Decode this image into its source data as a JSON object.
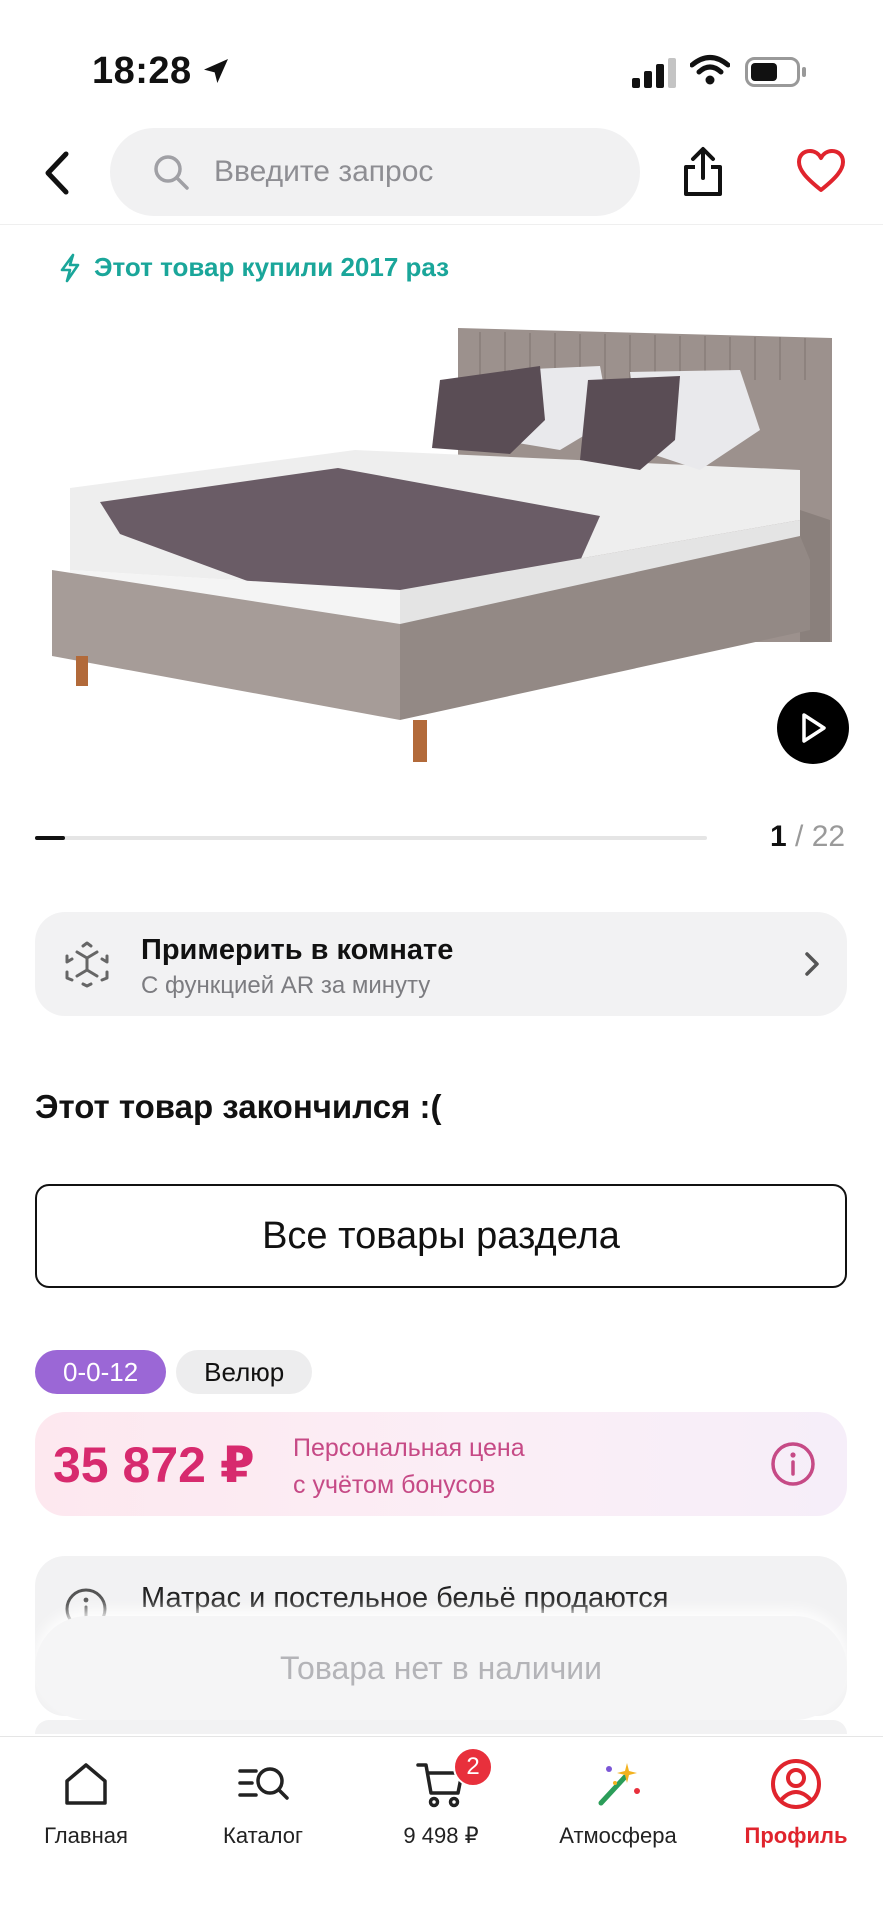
{
  "status_bar": {
    "time": "18:28"
  },
  "search": {
    "placeholder": "Введите запрос"
  },
  "product": {
    "bought_badge": "Этот товар купили 2017 раз",
    "gallery_current": "1",
    "gallery_separator": "/",
    "gallery_total": "22",
    "gallery_progress": 0.045,
    "ar": {
      "title": "Примерить в комнате",
      "subtitle": "С функцией AR за минуту"
    },
    "sold_out_text": "Этот товар закончился :(",
    "section_button": "Все товары раздела",
    "tags": [
      "0-0-12",
      "Велюр"
    ],
    "price": {
      "value": "35 872 ₽",
      "note_line1": "Персональная цена",
      "note_line2": "с учётом бонусов"
    },
    "info_text": "Матрас и постельное бельё продаются",
    "unavailable_button": "Товара нет в наличии"
  },
  "bottom_nav": {
    "items": [
      {
        "label": "Главная",
        "icon": "home-icon"
      },
      {
        "label": "Каталог",
        "icon": "catalog-icon"
      },
      {
        "label": "9 498 ₽",
        "icon": "cart-icon",
        "badge": "2"
      },
      {
        "label": "Атмосфера",
        "icon": "magic-wand-icon"
      },
      {
        "label": "Профиль",
        "icon": "profile-icon",
        "active": true
      }
    ]
  },
  "colors": {
    "accent": "#e0242d",
    "price": "#d72a6e",
    "teal": "#1aa69a",
    "tag_purple": "#9b67d6"
  }
}
